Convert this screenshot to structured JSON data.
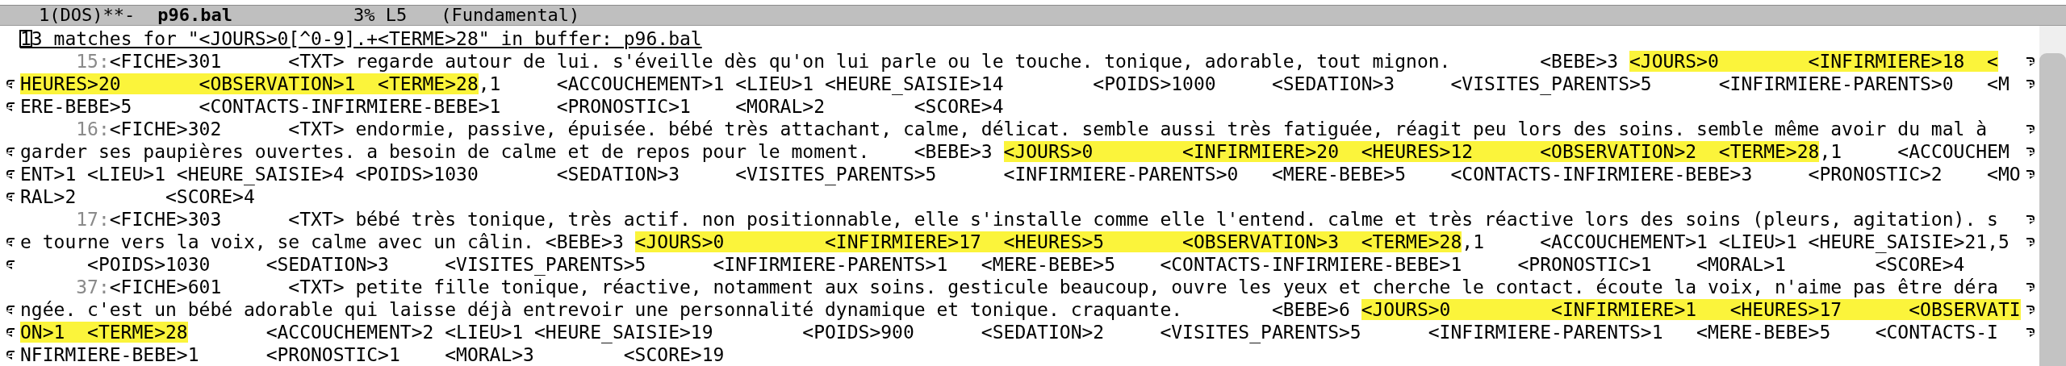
{
  "mode_line": {
    "status": "1(DOS)**-",
    "buffer": "p96.bal",
    "position": "3% L5",
    "mode": "(Fundamental)"
  },
  "header": {
    "text": "13 matches for \"<JOURS>0[^0-9].+<TERME>28\" in buffer: p96.bal"
  },
  "matches": [
    {
      "line_number": "15:",
      "rows": [
        [
          {
            "text": "<FICHE>301      <TXT> regarde autour de lui. s'éveille dès qu'on lui parle ou le touche. tonique, adorable, tout mignon.        <BEBE>3 ",
            "highlight": false
          },
          {
            "text": "<JOURS>0        <INFIRMIERE>18  <",
            "highlight": true
          }
        ],
        [
          {
            "text": "HEURES>20       <OBSERVATION>1  <TERME>28",
            "highlight": true
          },
          {
            "text": ",1     <ACCOUCHEMENT>1 <LIEU>1 <HEURE_SAISIE>14        <POIDS>1000     <SEDATION>3     <VISITES_PARENTS>5      <INFIRMIERE-PARENTS>0   <M",
            "highlight": false
          }
        ],
        [
          {
            "text": "ERE-BEBE>5      <CONTACTS-INFIRMIERE-BEBE>1     <PRONOSTIC>1    <MORAL>2        <SCORE>4",
            "highlight": false
          }
        ]
      ]
    },
    {
      "line_number": "16:",
      "rows": [
        [
          {
            "text": "<FICHE>302      <TXT> endormie, passive, épuisée. bébé très attachant, calme, délicat. semble aussi très fatiguée, réagit peu lors des soins. semble même avoir du mal à ",
            "highlight": false
          }
        ],
        [
          {
            "text": "garder ses paupières ouvertes. a besoin de calme et de repos pour le moment.    <BEBE>3 ",
            "highlight": false
          },
          {
            "text": "<JOURS>0        <INFIRMIERE>20  <HEURES>12      <OBSERVATION>2  <TERME>28",
            "highlight": true
          },
          {
            "text": ",1     <ACCOUCHEM",
            "highlight": false
          }
        ],
        [
          {
            "text": "ENT>1 <LIEU>1 <HEURE_SAISIE>4 <POIDS>1030       <SEDATION>3     <VISITES_PARENTS>5      <INFIRMIERE-PARENTS>0   <MERE-BEBE>5    <CONTACTS-INFIRMIERE-BEBE>3     <PRONOSTIC>2    <MO",
            "highlight": false
          }
        ],
        [
          {
            "text": "RAL>2        <SCORE>4",
            "highlight": false
          }
        ]
      ]
    },
    {
      "line_number": "17:",
      "rows": [
        [
          {
            "text": "<FICHE>303      <TXT> bébé très tonique, très actif. non positionnable, elle s'installe comme elle l'entend. calme et très réactive lors des soins (pleurs, agitation). s",
            "highlight": false
          }
        ],
        [
          {
            "text": "e tourne vers la voix, se calme avec un câlin. <BEBE>3 ",
            "highlight": false
          },
          {
            "text": "<JOURS>0         <INFIRMIERE>17  <HEURES>5       <OBSERVATION>3  <TERME>28",
            "highlight": true
          },
          {
            "text": ",1     <ACCOUCHEMENT>1 <LIEU>1 <HEURE_SAISIE>21,5",
            "highlight": false
          }
        ],
        [
          {
            "text": "      <POIDS>1030     <SEDATION>3     <VISITES_PARENTS>5      <INFIRMIERE-PARENTS>1   <MERE-BEBE>5    <CONTACTS-INFIRMIERE-BEBE>1     <PRONOSTIC>1    <MORAL>1        <SCORE>4",
            "highlight": false
          }
        ]
      ]
    },
    {
      "line_number": "37:",
      "rows": [
        [
          {
            "text": "<FICHE>601      <TXT> petite fille tonique, réactive, notamment aux soins. gesticule beaucoup, ouvre les yeux et cherche le contact. écoute la voix, n'aime pas être déra",
            "highlight": false
          }
        ],
        [
          {
            "text": "ngée. c'est un bébé adorable qui laisse déjà entrevoir une personnalité dynamique et tonique. craquante.        <BEBE>6 ",
            "highlight": false
          },
          {
            "text": "<JOURS>0         <INFIRMIERE>1   <HEURES>17      <OBSERVATI",
            "highlight": true
          }
        ],
        [
          {
            "text": "ON>1  <TERME>28",
            "highlight": true
          },
          {
            "text": "       <ACCOUCHEMENT>2 <LIEU>1 <HEURE_SAISIE>19        <POIDS>900      <SEDATION>2     <VISITES_PARENTS>5      <INFIRMIERE-PARENTS>1   <MERE-BEBE>5    <CONTACTS-I",
            "highlight": false
          }
        ],
        [
          {
            "text": "NFIRMIERE-BEBE>1      <PRONOSTIC>1    <MORAL>3        <SCORE>19",
            "highlight": false
          }
        ]
      ]
    }
  ]
}
